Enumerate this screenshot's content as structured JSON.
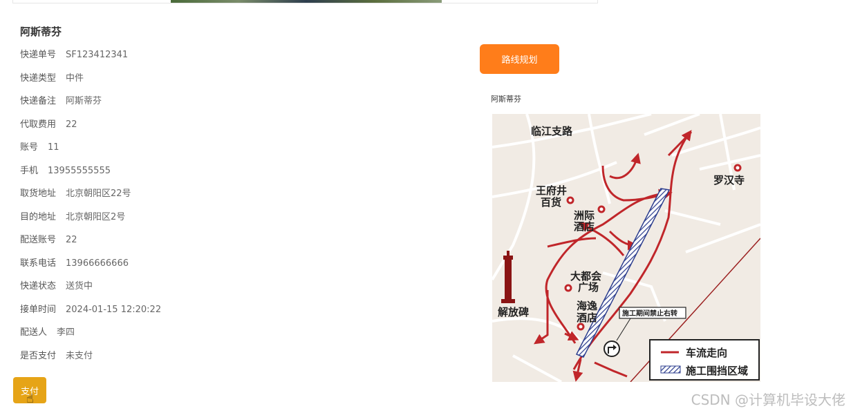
{
  "order": {
    "name": "阿斯蒂芬",
    "fields": [
      {
        "label": "快递单号",
        "value": "SF123412341"
      },
      {
        "label": "快递类型",
        "value": "中件"
      },
      {
        "label": "快递备注",
        "value": "阿斯蒂芬"
      },
      {
        "label": "代取费用",
        "value": "22"
      },
      {
        "label": "账号",
        "value": "11"
      },
      {
        "label": "手机",
        "value": "13955555555"
      },
      {
        "label": "取货地址",
        "value": "北京朝阳区22号"
      },
      {
        "label": "目的地址",
        "value": "北京朝阳区2号"
      },
      {
        "label": "配送账号",
        "value": "22"
      },
      {
        "label": "联系电话",
        "value": "13966666666"
      },
      {
        "label": "快递状态",
        "value": "送货中"
      },
      {
        "label": "接单时间",
        "value": "2024-01-15 12:20:22"
      },
      {
        "label": "配送人",
        "value": "李四"
      },
      {
        "label": "是否支付",
        "value": "未支付"
      }
    ],
    "pay_label": "支付"
  },
  "route": {
    "button_label": "路线规划",
    "caption": "阿斯蒂芬"
  },
  "map": {
    "labels": {
      "road": "临江支路",
      "wangfujing_1": "王府井",
      "wangfujing_2": "百货",
      "zhouji_1": "洲际",
      "zhouji_2": "酒店",
      "luohan": "罗汉寺",
      "dadu_1": "大都会",
      "dadu_2": "广场",
      "haiyi_1": "海逸",
      "haiyi_2": "酒店",
      "jiefangbei": "解放碑",
      "no_right_turn": "施工期间禁止右转"
    },
    "legend": {
      "traffic": "车流走向",
      "construction": "施工围挡区域"
    }
  },
  "watermark": "CSDN @计算机毕设大佬",
  "colors": {
    "route_button": "#ff7d1a",
    "pay_button": "#e6a417",
    "route_line": "#c0262a",
    "construction": "#2e3f8f"
  }
}
